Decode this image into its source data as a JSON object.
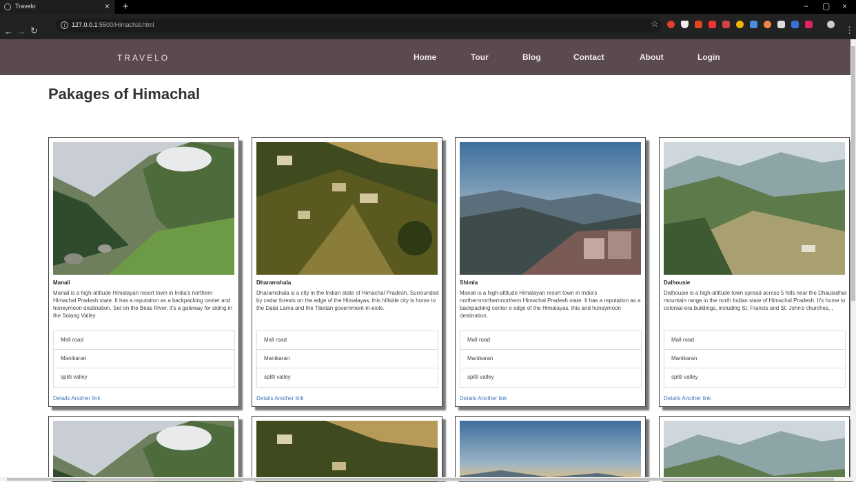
{
  "browser": {
    "tab_title": "Travelo",
    "url_host": "127.0.0.1",
    "url_path": ":5500/Himachal.html"
  },
  "site": {
    "brand": "TRAVELO",
    "nav": [
      "Home",
      "Tour",
      "Blog",
      "Contact",
      "About",
      "Login"
    ]
  },
  "page": {
    "title": "Pakages of Himachal"
  },
  "cards": [
    {
      "title": "Manali",
      "text": "Manali is a high-altitude Himalayan resort town in India's northern Himachal Pradesh state. It has a reputation as a backpacking center and honeymoon destination. Set on the Beas River, it's a gateway for skiing in the Solang Valley",
      "items": [
        "Mall road",
        "Manikaran",
        "spliti valley"
      ],
      "link1": "Details",
      "link2": "Another link"
    },
    {
      "title": "Dharamshala",
      "text": "Dharamshala is a city in the Indian state of Himachal Pradesh. Surrounded by cedar forests on the edge of the Himalayas, this hillside city is home to the Dalai Lama and the Tibetan government-in-exile.",
      "items": [
        "Mall road",
        "Manikaran",
        "spliti valley"
      ],
      "link1": "Details",
      "link2": "Another link"
    },
    {
      "title": "Shimla",
      "text": "Manali is a high-altitude Himalayan resort town in India's northernnorthernnorthern Himachal Pradesh state. It has a reputation as a backpacking center e edge of the Himalayas, this and honeymoon destination.",
      "items": [
        "Mall road",
        "Manikaran",
        "spliti valley"
      ],
      "link1": "Details",
      "link2": "Another link"
    },
    {
      "title": "Dalhousie",
      "text": "Dalhousie is a high-altitude town spread across 5 hills near the Dhauladhar mountain range in the north Indian state of Himachal Pradesh. It's home to colonial-era buildings, including St. Francis and St. John's churches, ,",
      "items": [
        "Mall road",
        "Manikaran",
        "spliti valley"
      ],
      "link1": "Details",
      "link2": "Another link"
    }
  ]
}
